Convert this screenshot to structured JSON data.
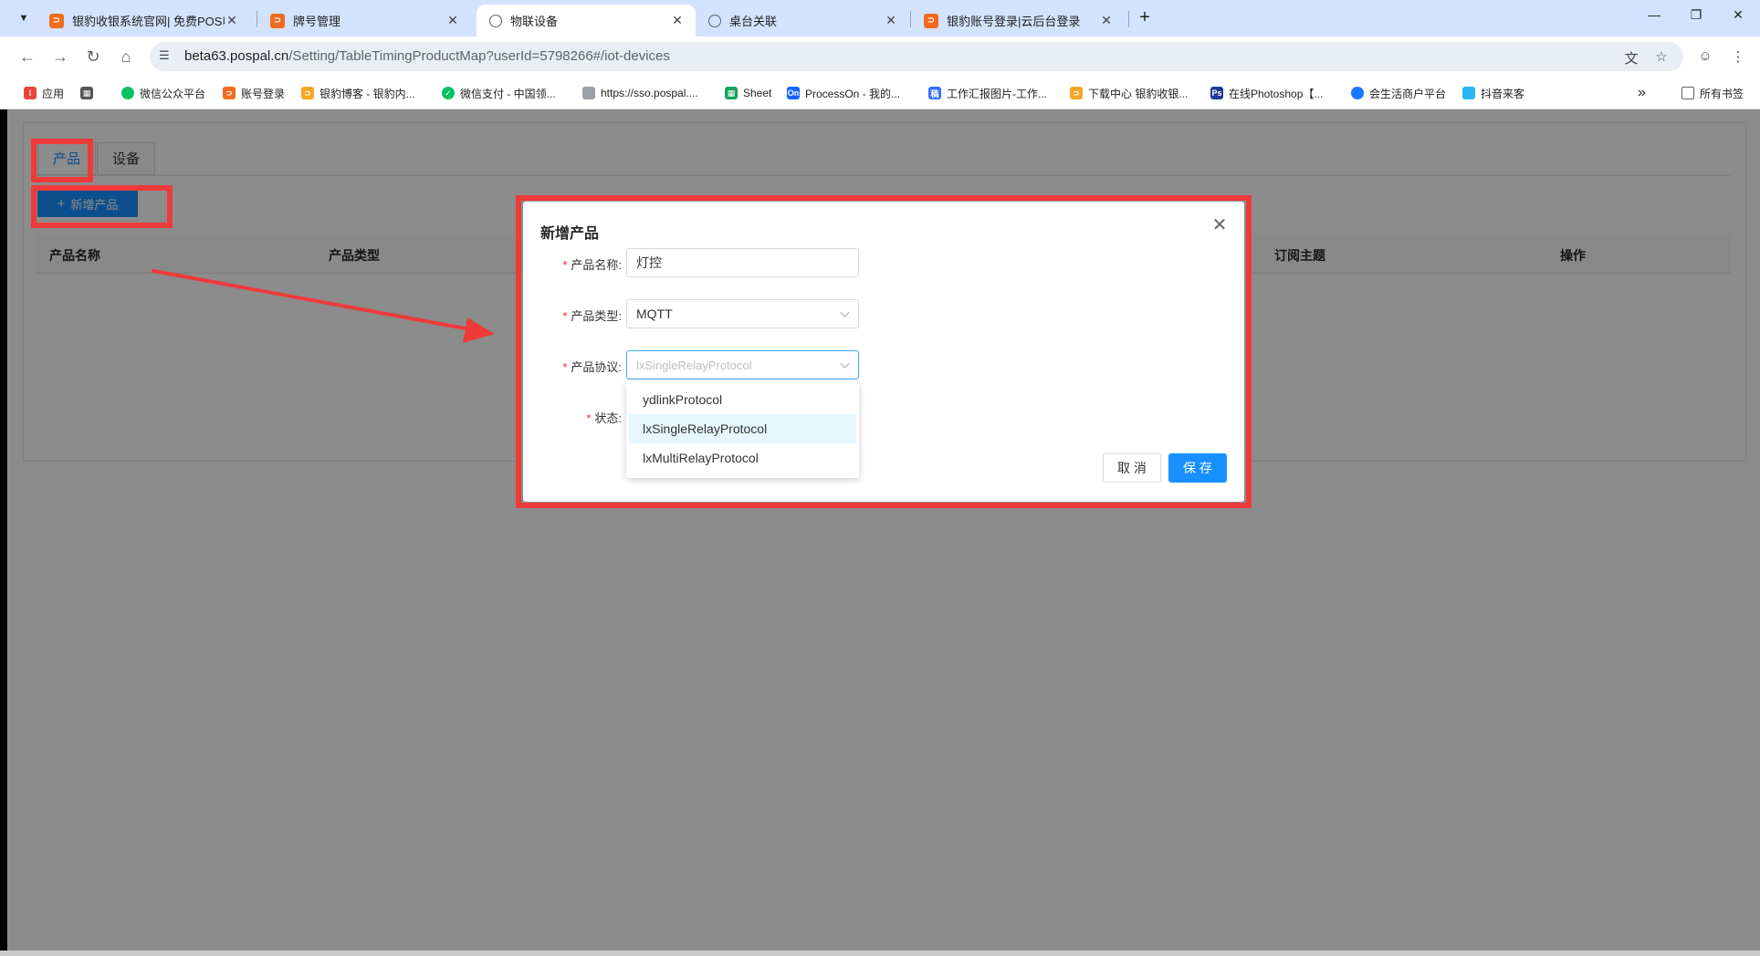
{
  "browser": {
    "tabs": [
      {
        "title": "银豹收银系统官网| 免费POS收",
        "favicon": "orange",
        "active": false
      },
      {
        "title": "牌号管理",
        "favicon": "orange",
        "active": false
      },
      {
        "title": "物联设备",
        "favicon": "globe",
        "active": true
      },
      {
        "title": "桌台关联",
        "favicon": "globe",
        "active": false
      },
      {
        "title": "银豹账号登录|云后台登录",
        "favicon": "orange",
        "active": false
      }
    ],
    "new_tab_icon": "plus-icon",
    "url_host": "beta63.pospal.cn",
    "url_path": "/Setting/TableTimingProductMap?userId=5798266#/iot-devices",
    "bookmarks": [
      {
        "label": "应用",
        "icon": "apps-grid-icon"
      },
      {
        "label": "",
        "icon": "grid-icon"
      },
      {
        "label": "微信公众平台",
        "icon": "wechat-icon"
      },
      {
        "label": "账号登录",
        "icon": "pospal-icon"
      },
      {
        "label": "银豹博客 - 银豹内...",
        "icon": "pospal-blog-icon"
      },
      {
        "label": "微信支付 - 中国领...",
        "icon": "wechat-pay-icon"
      },
      {
        "label": "https://sso.pospal....",
        "icon": "page-icon"
      },
      {
        "label": "Sheet",
        "icon": "sheet-icon"
      },
      {
        "label": "ProcessOn - 我的...",
        "icon": "processon-icon"
      },
      {
        "label": "工作汇报图片-工作...",
        "icon": "report-icon"
      },
      {
        "label": "下载中心 银豹收银...",
        "icon": "pospal-icon"
      },
      {
        "label": "在线Photoshop【...",
        "icon": "photoshop-icon"
      },
      {
        "label": "会生活商户平台",
        "icon": "life-icon"
      },
      {
        "label": "抖音来客",
        "icon": "douyin-icon"
      }
    ],
    "bookmarks_more": "»",
    "all_bookmarks": "所有书签"
  },
  "page": {
    "tabs": [
      "产品",
      "设备"
    ],
    "active_tab": "产品",
    "add_button": "新增产品",
    "table_headers": [
      "产品名称",
      "产品类型",
      "订阅主题",
      "操作"
    ]
  },
  "modal": {
    "title": "新增产品",
    "fields": {
      "name": {
        "label": "产品名称:",
        "value": "灯控"
      },
      "type": {
        "label": "产品类型:",
        "value": "MQTT"
      },
      "protocol": {
        "label": "产品协议:",
        "placeholder": "lxSingleRelayProtocol"
      },
      "status": {
        "label": "状态:"
      }
    },
    "protocol_options": [
      "ydlinkProtocol",
      "lxSingleRelayProtocol",
      "lxMultiRelayProtocol"
    ],
    "selected_option": "lxSingleRelayProtocol",
    "cancel": "取 消",
    "save": "保 存"
  },
  "colors": {
    "primary": "#1890ff",
    "highlight": "#ef3a3a",
    "tabbar": "#d3e3fd"
  }
}
